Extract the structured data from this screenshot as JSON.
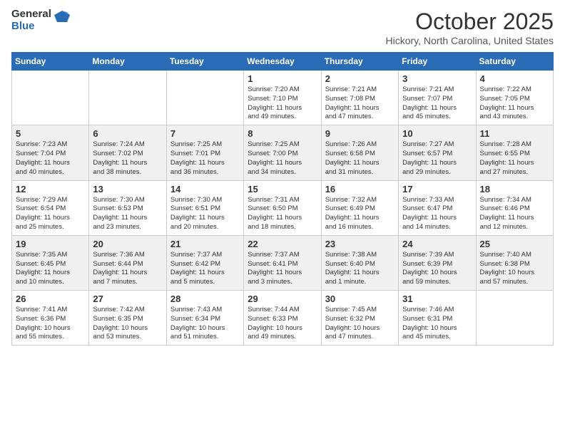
{
  "header": {
    "logo_general": "General",
    "logo_blue": "Blue",
    "month_title": "October 2025",
    "location": "Hickory, North Carolina, United States"
  },
  "weekdays": [
    "Sunday",
    "Monday",
    "Tuesday",
    "Wednesday",
    "Thursday",
    "Friday",
    "Saturday"
  ],
  "weeks": [
    [
      {
        "day": "",
        "info": ""
      },
      {
        "day": "",
        "info": ""
      },
      {
        "day": "",
        "info": ""
      },
      {
        "day": "1",
        "info": "Sunrise: 7:20 AM\nSunset: 7:10 PM\nDaylight: 11 hours\nand 49 minutes."
      },
      {
        "day": "2",
        "info": "Sunrise: 7:21 AM\nSunset: 7:08 PM\nDaylight: 11 hours\nand 47 minutes."
      },
      {
        "day": "3",
        "info": "Sunrise: 7:21 AM\nSunset: 7:07 PM\nDaylight: 11 hours\nand 45 minutes."
      },
      {
        "day": "4",
        "info": "Sunrise: 7:22 AM\nSunset: 7:05 PM\nDaylight: 11 hours\nand 43 minutes."
      }
    ],
    [
      {
        "day": "5",
        "info": "Sunrise: 7:23 AM\nSunset: 7:04 PM\nDaylight: 11 hours\nand 40 minutes."
      },
      {
        "day": "6",
        "info": "Sunrise: 7:24 AM\nSunset: 7:02 PM\nDaylight: 11 hours\nand 38 minutes."
      },
      {
        "day": "7",
        "info": "Sunrise: 7:25 AM\nSunset: 7:01 PM\nDaylight: 11 hours\nand 36 minutes."
      },
      {
        "day": "8",
        "info": "Sunrise: 7:25 AM\nSunset: 7:00 PM\nDaylight: 11 hours\nand 34 minutes."
      },
      {
        "day": "9",
        "info": "Sunrise: 7:26 AM\nSunset: 6:58 PM\nDaylight: 11 hours\nand 31 minutes."
      },
      {
        "day": "10",
        "info": "Sunrise: 7:27 AM\nSunset: 6:57 PM\nDaylight: 11 hours\nand 29 minutes."
      },
      {
        "day": "11",
        "info": "Sunrise: 7:28 AM\nSunset: 6:55 PM\nDaylight: 11 hours\nand 27 minutes."
      }
    ],
    [
      {
        "day": "12",
        "info": "Sunrise: 7:29 AM\nSunset: 6:54 PM\nDaylight: 11 hours\nand 25 minutes."
      },
      {
        "day": "13",
        "info": "Sunrise: 7:30 AM\nSunset: 6:53 PM\nDaylight: 11 hours\nand 23 minutes."
      },
      {
        "day": "14",
        "info": "Sunrise: 7:30 AM\nSunset: 6:51 PM\nDaylight: 11 hours\nand 20 minutes."
      },
      {
        "day": "15",
        "info": "Sunrise: 7:31 AM\nSunset: 6:50 PM\nDaylight: 11 hours\nand 18 minutes."
      },
      {
        "day": "16",
        "info": "Sunrise: 7:32 AM\nSunset: 6:49 PM\nDaylight: 11 hours\nand 16 minutes."
      },
      {
        "day": "17",
        "info": "Sunrise: 7:33 AM\nSunset: 6:47 PM\nDaylight: 11 hours\nand 14 minutes."
      },
      {
        "day": "18",
        "info": "Sunrise: 7:34 AM\nSunset: 6:46 PM\nDaylight: 11 hours\nand 12 minutes."
      }
    ],
    [
      {
        "day": "19",
        "info": "Sunrise: 7:35 AM\nSunset: 6:45 PM\nDaylight: 11 hours\nand 10 minutes."
      },
      {
        "day": "20",
        "info": "Sunrise: 7:36 AM\nSunset: 6:44 PM\nDaylight: 11 hours\nand 7 minutes."
      },
      {
        "day": "21",
        "info": "Sunrise: 7:37 AM\nSunset: 6:42 PM\nDaylight: 11 hours\nand 5 minutes."
      },
      {
        "day": "22",
        "info": "Sunrise: 7:37 AM\nSunset: 6:41 PM\nDaylight: 11 hours\nand 3 minutes."
      },
      {
        "day": "23",
        "info": "Sunrise: 7:38 AM\nSunset: 6:40 PM\nDaylight: 11 hours\nand 1 minute."
      },
      {
        "day": "24",
        "info": "Sunrise: 7:39 AM\nSunset: 6:39 PM\nDaylight: 10 hours\nand 59 minutes."
      },
      {
        "day": "25",
        "info": "Sunrise: 7:40 AM\nSunset: 6:38 PM\nDaylight: 10 hours\nand 57 minutes."
      }
    ],
    [
      {
        "day": "26",
        "info": "Sunrise: 7:41 AM\nSunset: 6:36 PM\nDaylight: 10 hours\nand 55 minutes."
      },
      {
        "day": "27",
        "info": "Sunrise: 7:42 AM\nSunset: 6:35 PM\nDaylight: 10 hours\nand 53 minutes."
      },
      {
        "day": "28",
        "info": "Sunrise: 7:43 AM\nSunset: 6:34 PM\nDaylight: 10 hours\nand 51 minutes."
      },
      {
        "day": "29",
        "info": "Sunrise: 7:44 AM\nSunset: 6:33 PM\nDaylight: 10 hours\nand 49 minutes."
      },
      {
        "day": "30",
        "info": "Sunrise: 7:45 AM\nSunset: 6:32 PM\nDaylight: 10 hours\nand 47 minutes."
      },
      {
        "day": "31",
        "info": "Sunrise: 7:46 AM\nSunset: 6:31 PM\nDaylight: 10 hours\nand 45 minutes."
      },
      {
        "day": "",
        "info": ""
      }
    ]
  ]
}
